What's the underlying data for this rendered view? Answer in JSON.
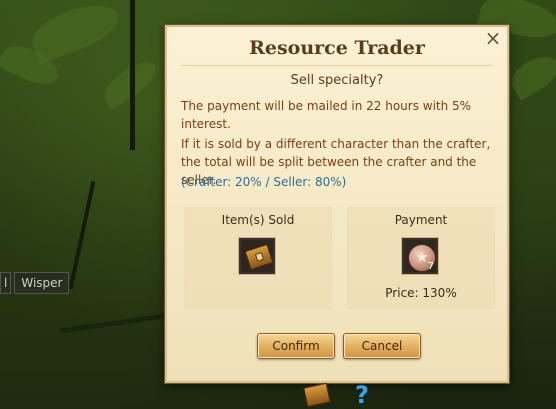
{
  "chat": {
    "tabs": [
      "l",
      "Wisper"
    ]
  },
  "dialog": {
    "title": "Resource Trader",
    "close_icon": "×",
    "question": "Sell specialty?",
    "message_line1": "The payment will be mailed in 22 hours with 5% interest.",
    "message_line2": "If it is sold by a different character than the crafter, the total will be split between the crafter and the seller.",
    "split_note": "(Crafter: 20% / Seller: 80%)",
    "items_sold": {
      "label": "Item(s) Sold",
      "icon": "specialty-chest-icon"
    },
    "payment": {
      "label": "Payment",
      "icon": "coin-icon",
      "quantity": "7",
      "price": "Price: 130%"
    },
    "buttons": {
      "confirm": "Confirm",
      "cancel": "Cancel"
    }
  },
  "hud": {
    "help_icon": "?"
  },
  "colors": {
    "dialog_bg": "#f4e7c3",
    "title": "#5a3c1d",
    "message": "#7b3f14",
    "split_note": "#2f6f96",
    "button": "#e2ae5c",
    "help": "#3aa3e6"
  }
}
